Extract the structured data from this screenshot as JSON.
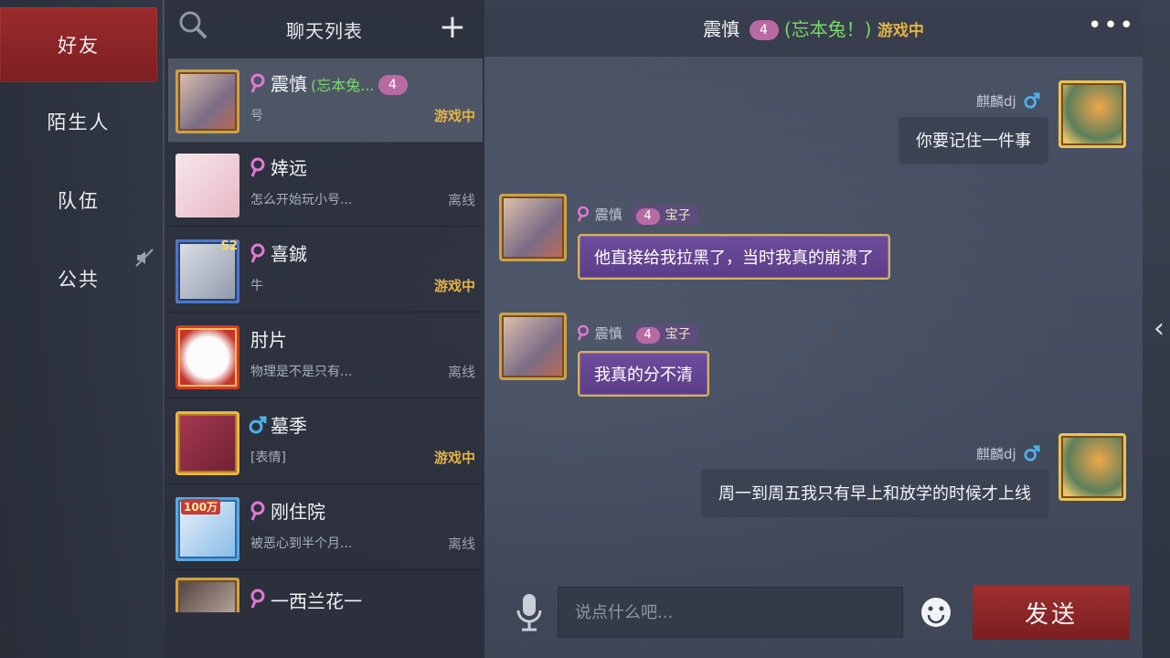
{
  "tabs": [
    {
      "label": "好友",
      "active": true
    },
    {
      "label": "陌生人",
      "active": false
    },
    {
      "label": "队伍",
      "active": false
    },
    {
      "label": "公共",
      "active": false
    }
  ],
  "chat_list": {
    "title": "聊天列表",
    "items": [
      {
        "name": "震慎",
        "gender": "female",
        "remark": "(忘本兔...",
        "intimacy": "4",
        "preview": "号",
        "status": "游戏中"
      },
      {
        "name": "婞远",
        "gender": "female",
        "remark": "",
        "intimacy": "",
        "preview": "怎么开始玩小号...",
        "status": "离线"
      },
      {
        "name": "喜鋮",
        "gender": "female",
        "remark": "",
        "intimacy": "",
        "preview": "牛",
        "status": "游戏中",
        "avatar_badge": "S2"
      },
      {
        "name": "肘片",
        "gender": "",
        "remark": "",
        "intimacy": "",
        "preview": "物理是不是只有...",
        "status": "离线"
      },
      {
        "name": "墓季",
        "gender": "male",
        "remark": "",
        "intimacy": "",
        "preview": "[表情]",
        "status": "游戏中"
      },
      {
        "name": "刚住院",
        "gender": "female",
        "remark": "",
        "intimacy": "",
        "preview": "被恶心到半个月...",
        "status": "离线",
        "avatar_badge": "100万"
      },
      {
        "name": "一西兰花一",
        "gender": "female",
        "remark": "",
        "intimacy": "",
        "preview": "",
        "status": ""
      }
    ]
  },
  "chat": {
    "name": "震慎",
    "intimacy": "4",
    "remark": "(忘本兔！)",
    "status": "游戏中",
    "messages": [
      {
        "from": "me",
        "sender": "麒麟dj",
        "text": "你要记住一件事"
      },
      {
        "from": "them",
        "sender": "震慎",
        "intimacy": "4",
        "title": "宝子",
        "text": "他直接给我拉黑了，当时我真的崩溃了"
      },
      {
        "from": "them",
        "sender": "震慎",
        "intimacy": "4",
        "title": "宝子",
        "text": "我真的分不清"
      },
      {
        "from": "me",
        "sender": "麒麟dj",
        "text": "周一到周五我只有早上和放学的时候才上线"
      }
    ],
    "input_placeholder": "说点什么吧...",
    "input_value": "",
    "send_label": "发送"
  },
  "colors": {
    "accent_red": "#8e2628",
    "ingame": "#e2b247",
    "remark_green": "#7bd86a",
    "female": "#e07ad0",
    "male": "#4fb0ea",
    "bubble_purple": "#5f4190"
  },
  "icons": [
    "search-icon",
    "plus-icon",
    "more-icon",
    "mute-icon",
    "mic-icon",
    "emoji-icon",
    "chevron-left-icon",
    "female-icon",
    "male-icon"
  ]
}
